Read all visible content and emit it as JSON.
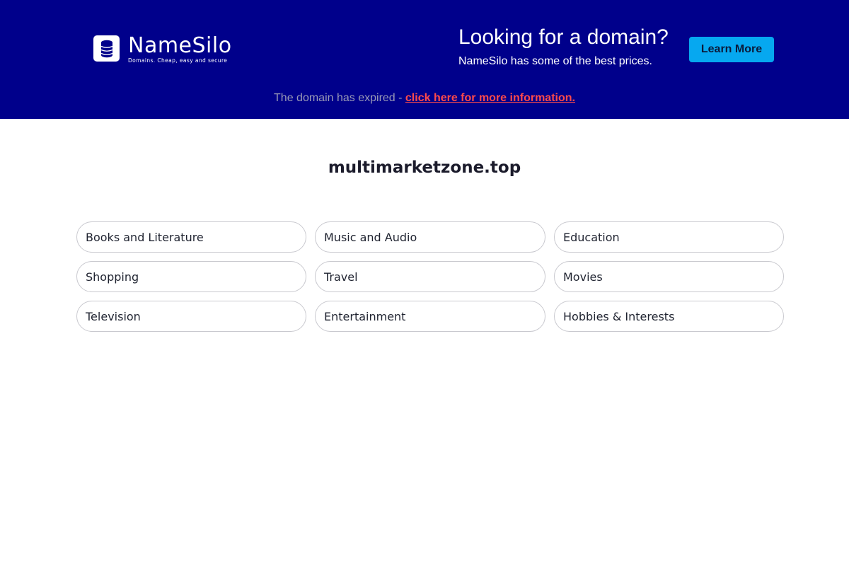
{
  "header": {
    "logo": {
      "name": "NameSilo",
      "tagline": "Domains. Cheap, easy and secure"
    },
    "promo_title": "Looking for a domain?",
    "promo_subtitle": "NameSilo has some of the best prices.",
    "learn_more_label": "Learn More",
    "expired_text": "The domain has expired - ",
    "expired_link": "click here for more information."
  },
  "main": {
    "domain": "multimarketzone.top",
    "categories": [
      "Books and Literature",
      "Music and Audio",
      "Education",
      "Shopping",
      "Travel",
      "Movies",
      "Television",
      "Entertainment",
      "Hobbies & Interests"
    ]
  },
  "colors": {
    "banner": "#00008b",
    "button": "#06a8f0",
    "link": "#ff4a4a"
  },
  "icons": {
    "logo_icon": "database-stack-icon"
  }
}
